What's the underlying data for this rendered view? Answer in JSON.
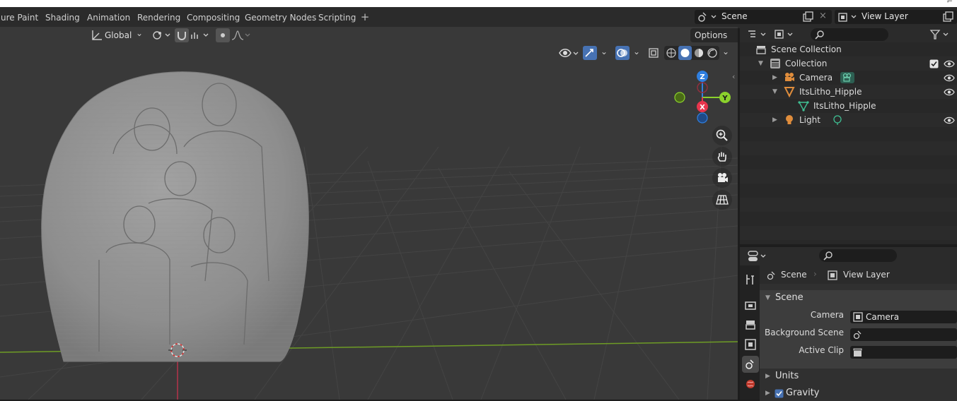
{
  "workspace_tabs": [
    "ure Paint",
    "Shading",
    "Animation",
    "Rendering",
    "Compositing",
    "Geometry Nodes",
    "Scripting"
  ],
  "scene_selector": {
    "value": "Scene"
  },
  "view_layer_selector": {
    "value": "View Layer"
  },
  "viewport": {
    "orientation": "Global",
    "options_label": "Options",
    "gizmo_axes": {
      "z": "Z",
      "y": "Y",
      "x": "X"
    },
    "colors": {
      "background": "#393939",
      "x_axis": "#e8354d",
      "y_axis": "#8bd12c",
      "z_axis": "#2f7fe0",
      "model": "#8f8f8f"
    }
  },
  "outliner": {
    "items": [
      {
        "label": "Scene Collection",
        "icon": "collection-icon"
      },
      {
        "label": "Collection",
        "icon": "collection-icon"
      },
      {
        "label": "Camera",
        "icon": "camera-object-icon"
      },
      {
        "label": "ItsLitho_Hipple",
        "icon": "mesh-object-icon"
      },
      {
        "label": "ItsLitho_Hipple",
        "icon": "mesh-data-icon"
      },
      {
        "label": "Light",
        "icon": "light-object-icon"
      }
    ]
  },
  "properties": {
    "breadcrumb": {
      "scene": "Scene",
      "view_layer": "View Layer"
    },
    "panel_scene": "Scene",
    "camera_label": "Camera",
    "camera_value": "Camera",
    "background_scene_label": "Background Scene",
    "active_clip_label": "Active Clip",
    "panel_units": "Units",
    "panel_gravity": "Gravity"
  }
}
